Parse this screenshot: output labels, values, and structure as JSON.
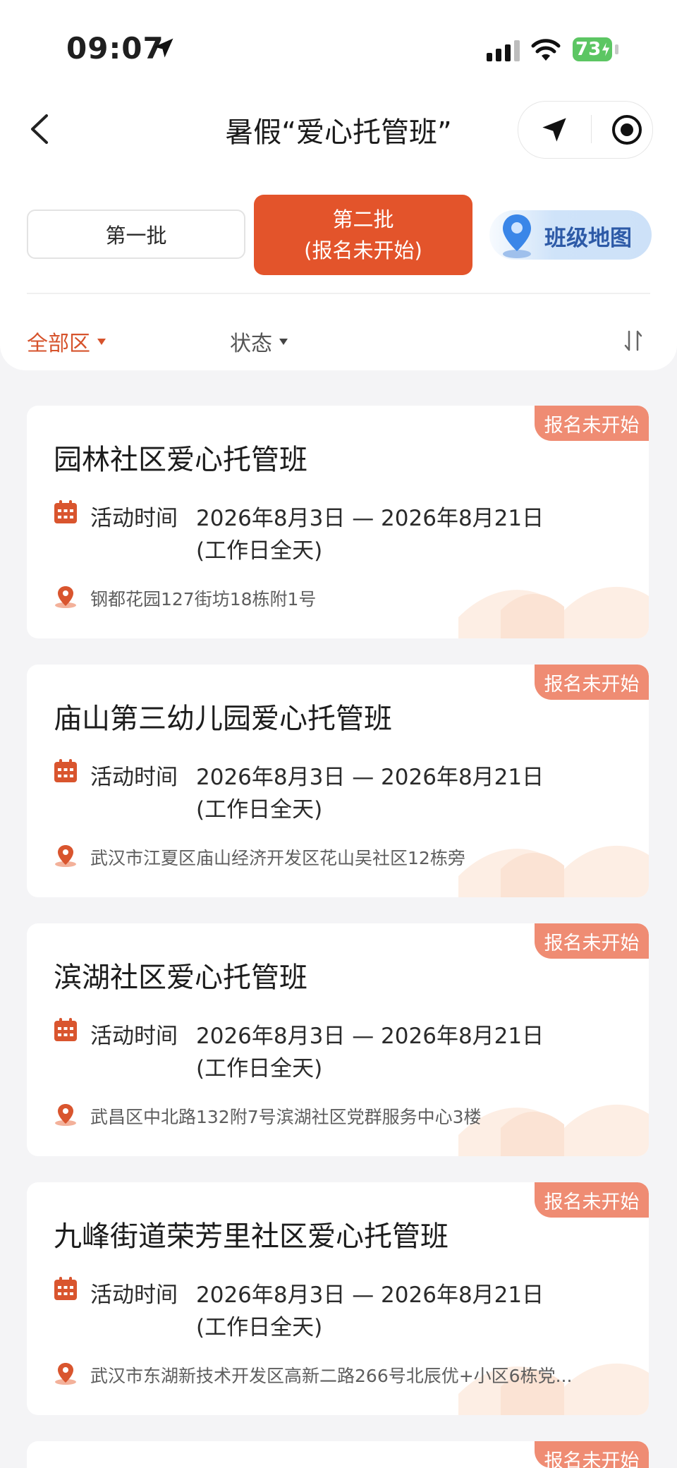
{
  "status_bar": {
    "time": "09:07",
    "battery": "73"
  },
  "nav": {
    "title": "暑假“爱心托管班”"
  },
  "batch_tabs": {
    "first": "第一批",
    "second_line1": "第二批",
    "second_line2": "(报名未开始)"
  },
  "map_button": {
    "label": "班级地图"
  },
  "filters": {
    "district": "全部区",
    "status": "状态"
  },
  "cards": [
    {
      "badge": "报名未开始",
      "title": "园林社区爱心托管班",
      "time_label": "活动时间",
      "time_range": "2026年8月3日 — 2026年8月21日",
      "time_note": "(工作日全天)",
      "address": "钢都花园127街坊18栋附1号"
    },
    {
      "badge": "报名未开始",
      "title": "庙山第三幼儿园爱心托管班",
      "time_label": "活动时间",
      "time_range": "2026年8月3日 — 2026年8月21日",
      "time_note": "(工作日全天)",
      "address": "武汉市江夏区庙山经济开发区花山吴社区12栋旁"
    },
    {
      "badge": "报名未开始",
      "title": "滨湖社区爱心托管班",
      "time_label": "活动时间",
      "time_range": "2026年8月3日 — 2026年8月21日",
      "time_note": "(工作日全天)",
      "address": "武昌区中北路132附7号滨湖社区党群服务中心3楼"
    },
    {
      "badge": "报名未开始",
      "title": "九峰街道荣芳里社区爱心托管班",
      "time_label": "活动时间",
      "time_range": "2026年8月3日 — 2026年8月21日",
      "time_note": "(工作日全天)",
      "address": "武汉市东湖新技术开发区高新二路266号北辰优+小区6栋党..."
    },
    {
      "badge": "报名未开始"
    }
  ],
  "colors": {
    "accent": "#e3542b",
    "badge": "#ef8c73",
    "map_text": "#2d5aa7",
    "battery": "#5cc663"
  },
  "icons": [
    "location-arrow-icon",
    "signal-icon",
    "wifi-icon",
    "battery-icon",
    "back-chevron-icon",
    "target-icon",
    "map-pin-icon",
    "caret-down-icon",
    "sort-icon",
    "calendar-icon",
    "location-pin-icon",
    "book-watermark-icon"
  ]
}
